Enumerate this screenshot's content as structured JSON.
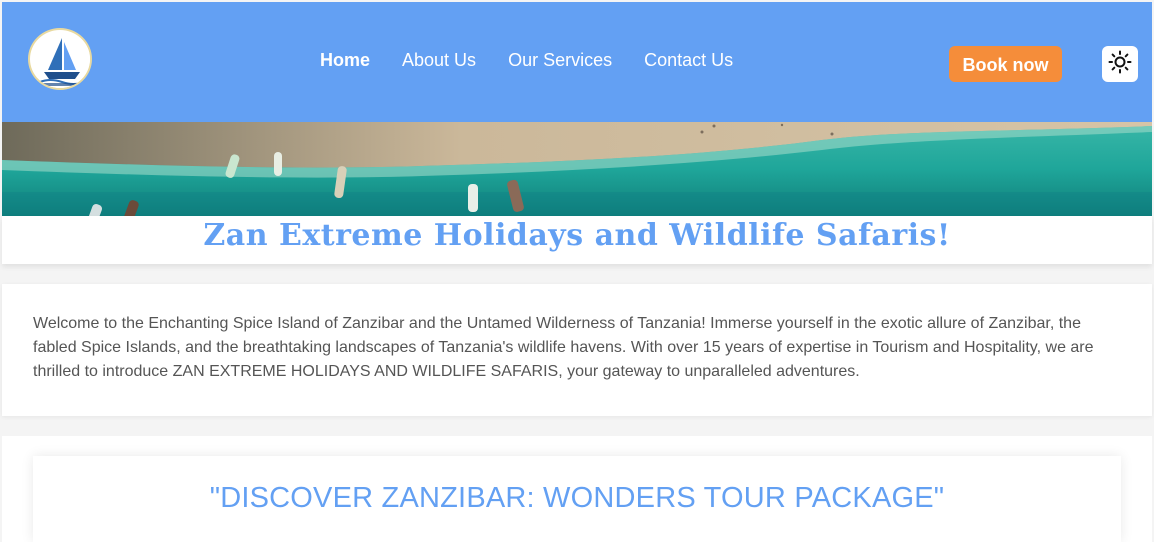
{
  "header": {
    "nav": [
      {
        "label": "Home",
        "active": true
      },
      {
        "label": "About Us",
        "active": false
      },
      {
        "label": "Our Services",
        "active": false
      },
      {
        "label": "Contact Us",
        "active": false
      }
    ],
    "book_button": "Book now",
    "theme_toggle_icon": "sun-icon",
    "logo_icon": "sailboat-logo-icon",
    "colors": {
      "header_bg": "#63a0f3",
      "book_bg": "#f58d3a",
      "accent": "#63a0f3"
    }
  },
  "hero": {
    "title": "Zan Extreme Holidays and Wildlife Safaris!"
  },
  "welcome": {
    "text": "Welcome to the Enchanting Spice Island of Zanzibar and the Untamed Wilderness of Tanzania! Immerse yourself in the exotic allure of Zanzibar, the fabled Spice Islands, and the breathtaking landscapes of Tanzania's wildlife havens. With over 15 years of expertise in Tourism and Hospitality, we are thrilled to introduce ZAN EXTREME HOLIDAYS AND WILDLIFE SAFARIS, your gateway to unparalleled adventures."
  },
  "discover": {
    "heading": "\"DISCOVER ZANZIBAR: WONDERS TOUR PACKAGE\""
  }
}
